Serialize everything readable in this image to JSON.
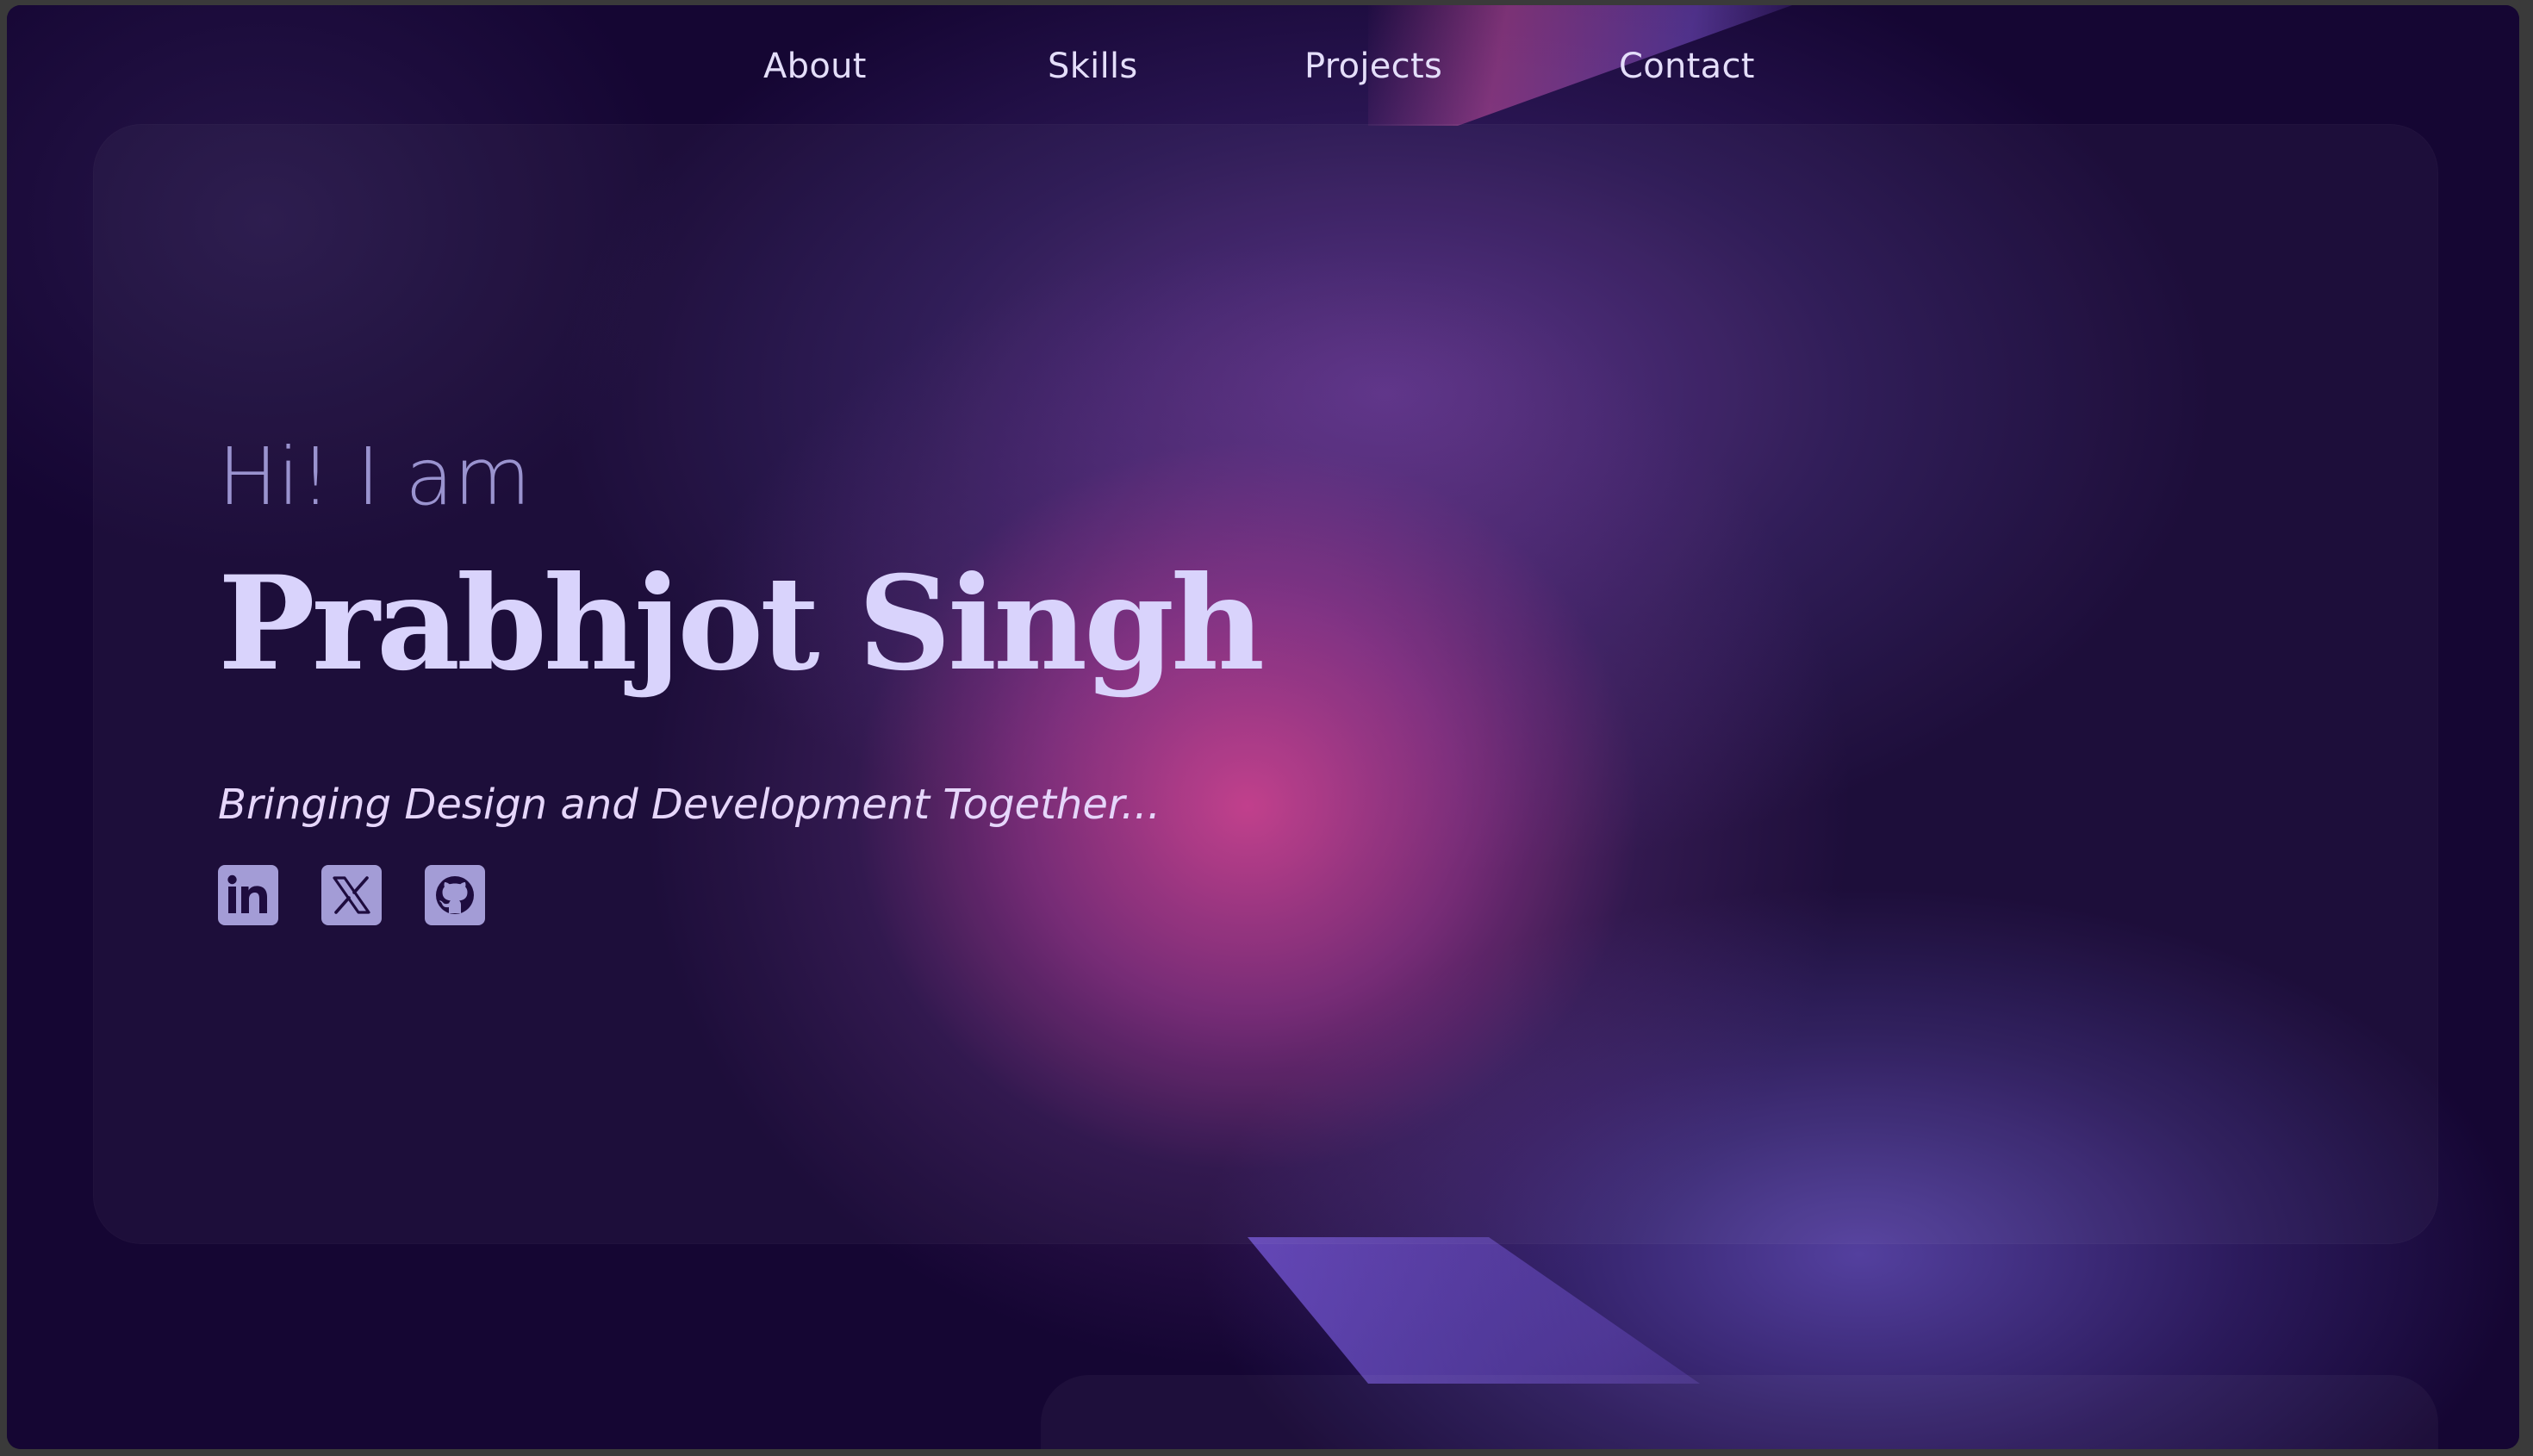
{
  "nav": {
    "items": [
      {
        "label": "About"
      },
      {
        "label": "Skills"
      },
      {
        "label": "Projects"
      },
      {
        "label": "Contact"
      }
    ]
  },
  "hero": {
    "greeting": "Hi! I am",
    "name": "Prabhjot Singh",
    "tagline": "Bringing Design and Development Together..."
  },
  "socials": [
    {
      "icon": "linkedin-icon"
    },
    {
      "icon": "x-twitter-icon"
    },
    {
      "icon": "github-icon"
    }
  ],
  "colors": {
    "background": "#150633",
    "accent_pink": "#c83c8c",
    "accent_purple": "#5a46aa",
    "name_text": "#d9d3fc",
    "greeting_text": "#9a93cf",
    "icon_fill": "#a39cd6"
  }
}
